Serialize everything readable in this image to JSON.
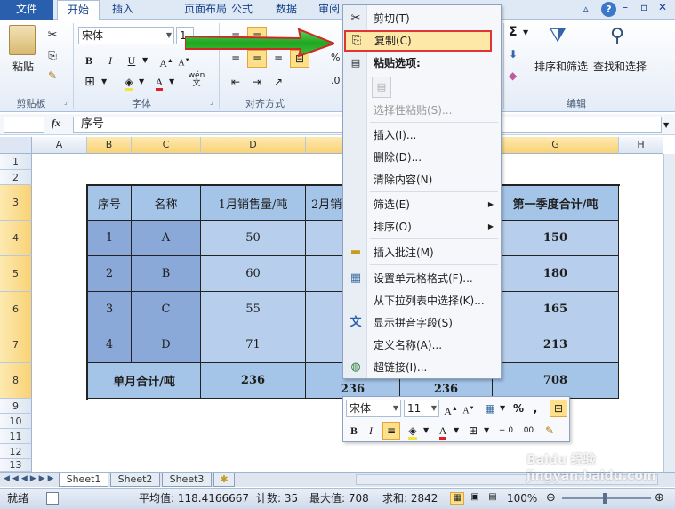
{
  "ribbon": {
    "tabs": [
      "文件",
      "开始",
      "插入",
      "页面布局",
      "公式",
      "数据",
      "审阅"
    ],
    "active_tab": "开始",
    "groups": {
      "clipboard": "剪贴板",
      "font": "字体",
      "align": "对齐方式",
      "edit": "编辑"
    },
    "paste_label": "粘贴",
    "font_name": "宋体",
    "font_size": "1",
    "bold": "B",
    "italic": "I",
    "underline": "U",
    "sort_filter": "排序和筛选",
    "find_select": "查找和选择",
    "wen": "wén 文"
  },
  "formula_bar": {
    "fx": "fx",
    "content": "序号"
  },
  "columns": [
    "A",
    "B",
    "C",
    "D",
    "E",
    "F",
    "G",
    "H"
  ],
  "rows": [
    "1",
    "2",
    "3",
    "4",
    "5",
    "6",
    "7",
    "8",
    "9",
    "10",
    "11",
    "12",
    "13"
  ],
  "table": {
    "headers": [
      "序号",
      "名称",
      "1月销售量/吨",
      "2月销",
      "",
      "第一季度合计/吨"
    ],
    "rows": [
      [
        "1",
        "A",
        "50",
        "",
        "",
        "150"
      ],
      [
        "2",
        "B",
        "60",
        "",
        "",
        "180"
      ],
      [
        "3",
        "C",
        "55",
        "",
        "",
        "165"
      ],
      [
        "4",
        "D",
        "71",
        "",
        "",
        "213"
      ]
    ],
    "total_row": [
      "单月合计/吨",
      "236",
      "236",
      "236",
      "708"
    ]
  },
  "context_menu": {
    "items": [
      {
        "label": "剪切(T)",
        "icon": "scissors-icon",
        "glyph": "✂"
      },
      {
        "label": "复制(C)",
        "icon": "copy-icon",
        "glyph": "⎘"
      },
      {
        "label": "粘贴选项:",
        "icon": "paste-icon",
        "glyph": "📋"
      },
      {
        "label": "选择性粘贴(S)..."
      },
      {
        "label": "插入(I)..."
      },
      {
        "label": "删除(D)..."
      },
      {
        "label": "清除内容(N)"
      },
      {
        "label": "筛选(E)"
      },
      {
        "label": "排序(O)"
      },
      {
        "label": "插入批注(M)",
        "icon": "comment-icon",
        "glyph": "▭"
      },
      {
        "label": "设置单元格格式(F)...",
        "icon": "format-cells-icon",
        "glyph": "▦"
      },
      {
        "label": "从下拉列表中选择(K)..."
      },
      {
        "label": "显示拼音字段(S)",
        "icon": "phonetic-icon",
        "glyph": "文"
      },
      {
        "label": "定义名称(A)..."
      },
      {
        "label": "超链接(I)...",
        "icon": "hyperlink-icon",
        "glyph": "🌐"
      }
    ]
  },
  "mini_toolbar": {
    "font_name": "宋体",
    "font_size": "11",
    "percent": "%",
    "comma": ","
  },
  "sheets": [
    "Sheet1",
    "Sheet2",
    "Sheet3"
  ],
  "status": {
    "ready": "就绪",
    "average": "平均值: 118.4166667",
    "count": "计数: 35",
    "max": "最大值: 708",
    "sum": "求和: 2842",
    "zoom": "100%"
  },
  "watermark": "Baidu 经验 jingyan.baidu.com"
}
